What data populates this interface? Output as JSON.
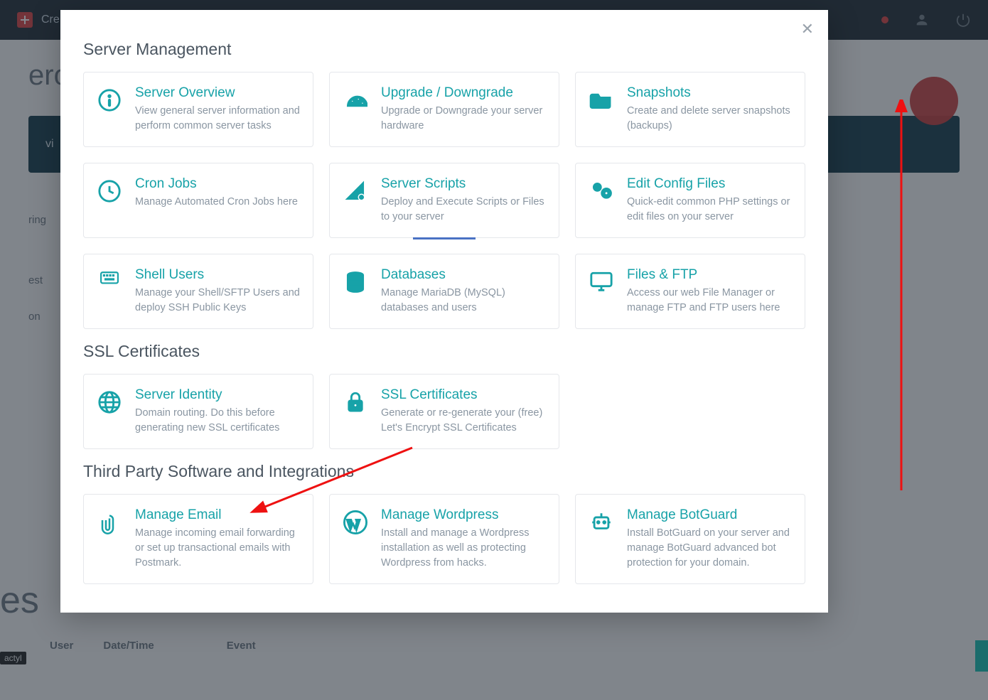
{
  "topbar": {
    "create": "Cre",
    "overview": "vi"
  },
  "modal": {
    "title1": "Server Management",
    "title2": "SSL Certificates",
    "title3": "Third Party Software and Integrations",
    "cards": {
      "overview": {
        "t": "Server Overview",
        "d": "View general server information and perform common server tasks"
      },
      "upgrade": {
        "t": "Upgrade / Downgrade",
        "d": "Upgrade or Downgrade your server hardware"
      },
      "snapshots": {
        "t": "Snapshots",
        "d": "Create and delete server snapshots (backups)"
      },
      "cron": {
        "t": "Cron Jobs",
        "d": "Manage Automated Cron Jobs here"
      },
      "scripts": {
        "t": "Server Scripts",
        "d": "Deploy and Execute Scripts or Files to your server"
      },
      "config": {
        "t": "Edit Config Files",
        "d": "Quick-edit common PHP settings or edit files on your server"
      },
      "shell": {
        "t": "Shell Users",
        "d": "Manage your Shell/SFTP Users and deploy SSH Public Keys"
      },
      "db": {
        "t": "Databases",
        "d": "Manage MariaDB (MySQL) databases and users"
      },
      "files": {
        "t": "Files & FTP",
        "d": "Access our web File Manager or manage FTP and FTP users here"
      },
      "identity": {
        "t": "Server Identity",
        "d": "Domain routing. Do this before generating new SSL certificates"
      },
      "ssl": {
        "t": "SSL Certificates",
        "d": "Generate or re-generate your (free) Let's Encrypt SSL Certificates"
      },
      "email": {
        "t": "Manage Email",
        "d": "Manage incoming email forwarding or set up transactional emails with Postmark."
      },
      "wp": {
        "t": "Manage Wordpress",
        "d": "Install and manage a Wordpress installation as well as protecting Wordpress from hacks."
      },
      "botguard": {
        "t": "Manage BotGuard",
        "d": "Install BotGuard on your server and manage BotGuard advanced bot protection for your domain."
      }
    }
  },
  "bg": {
    "side": [
      "",
      "ring",
      "",
      "est",
      "on",
      ""
    ],
    "tbl": [
      "User",
      "Date/Time",
      "Event"
    ],
    "tag": "actyl",
    "title_suffix": "ero",
    "footer_word": "es"
  }
}
